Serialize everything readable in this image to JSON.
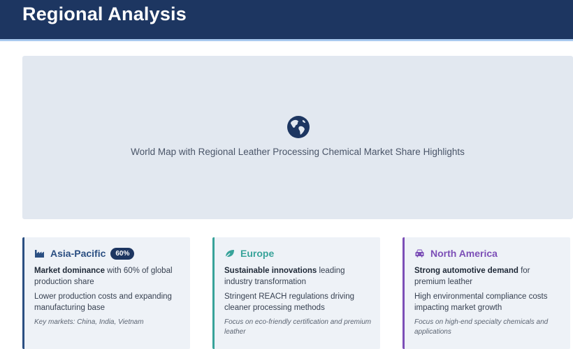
{
  "page": {
    "title": "Regional Analysis"
  },
  "map": {
    "icon": "globe-icon",
    "caption": "World Map with Regional Leather Processing Chemical Market Share Highlights"
  },
  "regions": [
    {
      "name": "Asia-Pacific",
      "icon": "factory-icon",
      "badge": "60%",
      "accent": "#2b4f82",
      "highlight_bold": "Market dominance",
      "highlight_rest": " with 60% of global production share",
      "detail": "Lower production costs and expanding manufacturing base",
      "note": "Key markets: China, India, Vietnam"
    },
    {
      "name": "Europe",
      "icon": "leaf-icon",
      "accent": "#38a39a",
      "highlight_bold": "Sustainable innovations",
      "highlight_rest": " leading industry transformation",
      "detail": "Stringent REACH regulations driving cleaner processing methods",
      "note": "Focus on eco-friendly certification and premium leather"
    },
    {
      "name": "North America",
      "icon": "car-icon",
      "accent": "#7c4fb7",
      "highlight_bold": "Strong automotive demand",
      "highlight_rest": " for premium leather",
      "detail": "High environmental compliance costs impacting market growth",
      "note": "Focus on high-end specialty chemicals and applications"
    }
  ]
}
